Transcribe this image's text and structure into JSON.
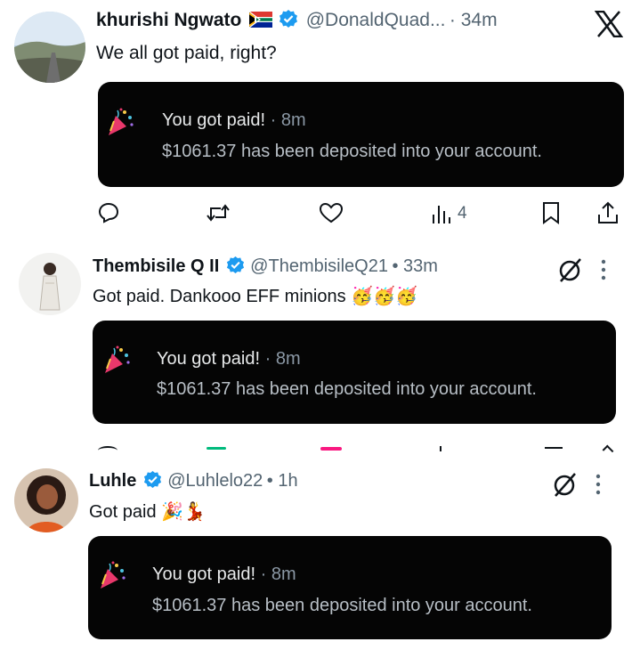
{
  "posts": [
    {
      "author": "khurishi Ngwato",
      "handle": "@DonaldQuad...",
      "time": "· 34m",
      "text": "We all got paid, right?",
      "notification": {
        "title": "You got paid!",
        "time": "· 8m",
        "message": "$1061.37 has been deposited into your account."
      },
      "views": "4"
    },
    {
      "author": "Thembisile Q II",
      "handle": "@ThembisileQ21",
      "time": "• 33m",
      "text": "Got paid. Dankooo EFF minions 🥳🥳🥳",
      "notification": {
        "title": "You got paid!",
        "time": "· 8m",
        "message": "$1061.37 has been deposited into your account."
      }
    },
    {
      "author": "Luhle",
      "handle": "@Luhlelo22",
      "time": "• 1h",
      "text": "Got paid 🎉💃",
      "notification": {
        "title": "You got paid!",
        "time": "· 8m",
        "message": "$1061.37 has been deposited into your account."
      }
    }
  ],
  "colors": {
    "verified": "#1d9bf0",
    "notification_bg": "#050505",
    "muted": "#536471"
  },
  "icons": [
    "x-logo-icon",
    "south-africa-flag-icon",
    "verified-badge-icon",
    "party-popper-icon",
    "reply-icon",
    "retweet-icon",
    "like-icon",
    "views-icon",
    "bookmark-icon",
    "share-icon",
    "grok-icon",
    "more-icon"
  ]
}
